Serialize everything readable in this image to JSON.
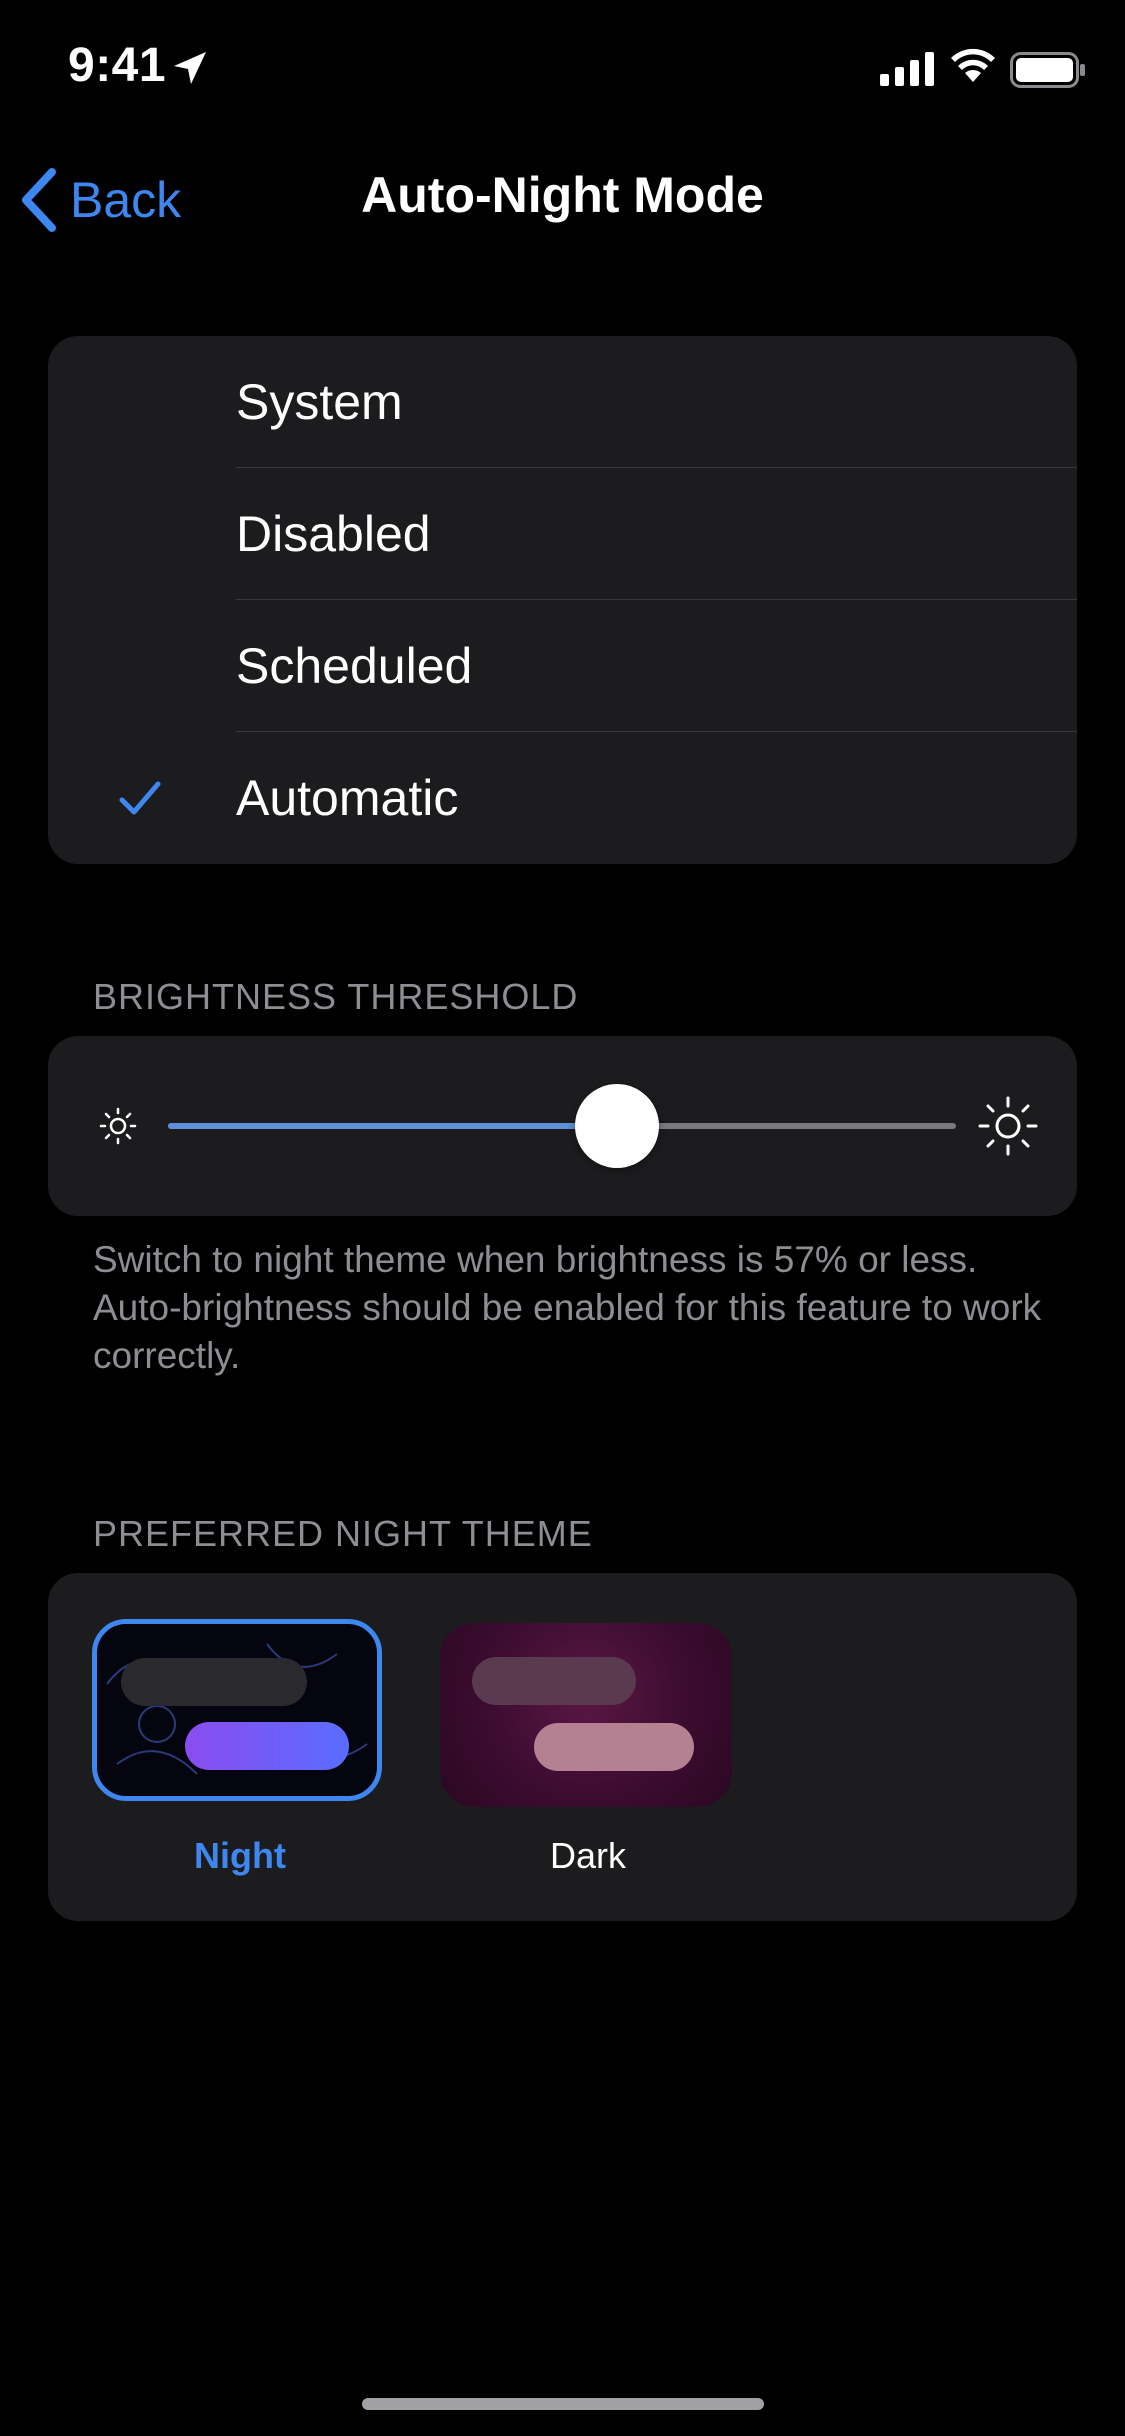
{
  "status_bar": {
    "time": "9:41"
  },
  "nav": {
    "back_label": "Back",
    "title": "Auto-Night Mode"
  },
  "modes": [
    {
      "label": "System",
      "selected": false
    },
    {
      "label": "Disabled",
      "selected": false
    },
    {
      "label": "Scheduled",
      "selected": false
    },
    {
      "label": "Automatic",
      "selected": true
    }
  ],
  "brightness": {
    "header": "BRIGHTNESS THRESHOLD",
    "value_percent": 57,
    "note": "Switch to night theme when brightness is 57% or less. Auto-brightness should be enabled for this feature to work correctly."
  },
  "themes": {
    "header": "PREFERRED NIGHT THEME",
    "items": [
      {
        "label": "Night",
        "selected": true
      },
      {
        "label": "Dark",
        "selected": false
      }
    ]
  },
  "colors": {
    "accent": "#3e87f0",
    "background": "#000000",
    "group": "#1c1c1e",
    "secondary_text": "#8d8d93"
  }
}
